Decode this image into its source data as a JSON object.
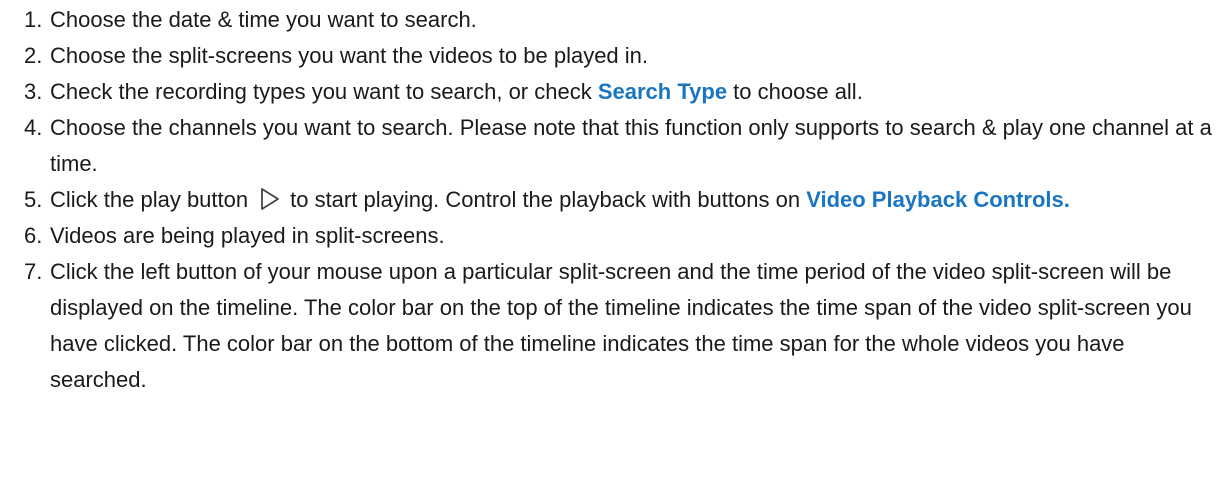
{
  "steps": [
    {
      "num": "1.",
      "text": "Choose the date & time you want to search."
    },
    {
      "num": "2.",
      "text": "Choose the split-screens you want the videos to be played in."
    },
    {
      "num": "3.",
      "pre": "Check the recording types you want to search, or check ",
      "link": "Search Type",
      "post": " to choose all."
    },
    {
      "num": "4.",
      "text": "Choose the channels you want to search. Please note that this function only supports to search & play one channel at a time."
    },
    {
      "num": "5.",
      "pre": "Click the play button",
      "icon": "play-icon",
      "mid": "to start playing. Control the playback with buttons on ",
      "link": "Video Playback Controls."
    },
    {
      "num": "6.",
      "text": "Videos are being played in split-screens."
    },
    {
      "num": "7.",
      "text": "Click the left button of your mouse upon a particular split-screen and the time period of the video split-screen will be displayed on the timeline. The color bar on the top of the timeline indicates the time span of the video split-screen you have clicked. The color bar on the bottom of the timeline indicates the time span for the whole videos you have searched."
    }
  ],
  "colors": {
    "link": "#1a75c2",
    "text": "#1a1a1a"
  }
}
